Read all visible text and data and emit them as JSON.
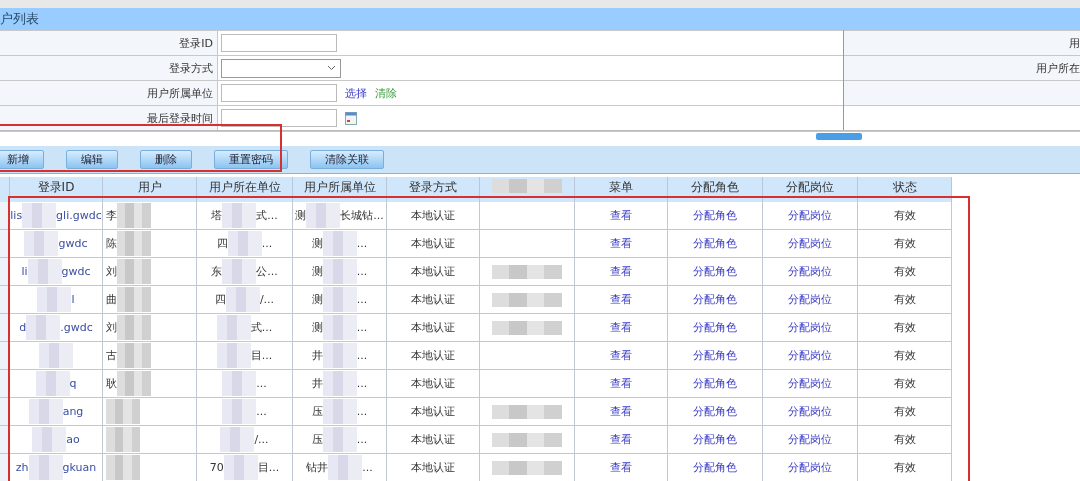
{
  "title": "户列表",
  "form": {
    "rows": [
      {
        "label": "登录ID",
        "kind": "text"
      },
      {
        "label": "登录方式",
        "kind": "select"
      },
      {
        "label": "用户所属单位",
        "kind": "picker",
        "links": [
          {
            "text": "选择",
            "kind": "select"
          },
          {
            "text": "清除",
            "kind": "clear"
          }
        ]
      },
      {
        "label": "最后登录时间",
        "kind": "date"
      }
    ],
    "right_labels": [
      "用",
      "用户所在"
    ]
  },
  "toolbar": [
    "新增",
    "编辑",
    "删除",
    "重置密码",
    "清除关联"
  ],
  "table": {
    "columns": [
      "登录ID",
      "用户",
      "用户所在单位",
      "用户所属单位",
      "登录方式",
      null,
      "菜单",
      "分配角色",
      "分配岗位",
      "状态"
    ],
    "rows": [
      {
        "login_id": {
          "start": "lis",
          "end": "gli.gwdc"
        },
        "name": "李",
        "unit": {
          "start": "塔",
          "end": "式..."
        },
        "org": {
          "start": "测",
          "end": "长城钻..."
        },
        "method": "本地认证",
        "last_login_redacted": false,
        "menu": "查看",
        "role": "分配角色",
        "post": "分配岗位",
        "status": "有效"
      },
      {
        "login_id": {
          "end": "gwdc"
        },
        "name": "陈",
        "unit": {
          "start": "四",
          "end": "..."
        },
        "org": {
          "start": "测",
          "end": "..."
        },
        "method": "本地认证",
        "last_login_redacted": false,
        "menu": "查看",
        "role": "分配角色",
        "post": "分配岗位",
        "status": "有效"
      },
      {
        "login_id": {
          "start": "li",
          "end": "gwdc"
        },
        "name": "刘",
        "unit": {
          "start": "东",
          "end": "公..."
        },
        "org": {
          "start": "测",
          "end": "..."
        },
        "method": "本地认证",
        "last_login_redacted": true,
        "menu": "查看",
        "role": "分配角色",
        "post": "分配岗位",
        "status": "有效"
      },
      {
        "login_id": {
          "end": "l"
        },
        "name": "曲",
        "unit": {
          "start": "四",
          "end": "/..."
        },
        "org": {
          "start": "测",
          "end": "..."
        },
        "method": "本地认证",
        "last_login_redacted": true,
        "menu": "查看",
        "role": "分配角色",
        "post": "分配岗位",
        "status": "有效"
      },
      {
        "login_id": {
          "start": "d",
          "end": ".gwdc"
        },
        "name": "刘",
        "unit": {
          "end": "式..."
        },
        "org": {
          "start": "测",
          "end": "..."
        },
        "method": "本地认证",
        "last_login_redacted": true,
        "menu": "查看",
        "role": "分配角色",
        "post": "分配岗位",
        "status": "有效"
      },
      {
        "login_id": {},
        "name": "古",
        "unit": {
          "end": "目..."
        },
        "org": {
          "start": "井",
          "end": "..."
        },
        "method": "本地认证",
        "last_login_redacted": false,
        "menu": "查看",
        "role": "分配角色",
        "post": "分配岗位",
        "status": "有效"
      },
      {
        "login_id": {
          "end": "q"
        },
        "name": "耿",
        "unit": {
          "end": "..."
        },
        "org": {
          "start": "井",
          "end": "..."
        },
        "method": "本地认证",
        "last_login_redacted": false,
        "menu": "查看",
        "role": "分配角色",
        "post": "分配岗位",
        "status": "有效"
      },
      {
        "login_id": {
          "end": "ang"
        },
        "unit": {
          "end": "..."
        },
        "org": {
          "start": "压",
          "end": "..."
        },
        "method": "本地认证",
        "last_login_redacted": true,
        "menu": "查看",
        "role": "分配角色",
        "post": "分配岗位",
        "status": "有效"
      },
      {
        "login_id": {
          "end": "ao"
        },
        "unit": {
          "end": "/..."
        },
        "org": {
          "start": "压",
          "end": "..."
        },
        "method": "本地认证",
        "last_login_redacted": true,
        "menu": "查看",
        "role": "分配角色",
        "post": "分配岗位",
        "status": "有效"
      },
      {
        "login_id": {
          "start": "zh",
          "end": "gkuan"
        },
        "unit": {
          "start": "70",
          "end": "目..."
        },
        "org": {
          "start": "钻井",
          "end": "..."
        },
        "method": "本地认证",
        "last_login_redacted": true,
        "menu": "查看",
        "role": "分配角色",
        "post": "分配岗位",
        "status": "有效"
      }
    ]
  }
}
